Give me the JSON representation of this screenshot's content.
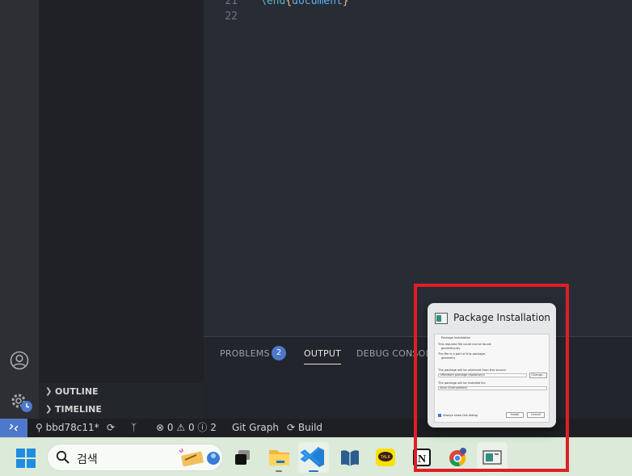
{
  "editor": {
    "lines": [
      {
        "number": "21",
        "keyword": "\\end",
        "open": "{",
        "arg": "document",
        "close": "}"
      },
      {
        "number": "22",
        "keyword": "",
        "open": "",
        "arg": "",
        "close": ""
      }
    ]
  },
  "sidebar": {
    "sections": [
      {
        "label": "OUTLINE"
      },
      {
        "label": "TIMELINE"
      }
    ]
  },
  "panel": {
    "tabs": [
      "PROBLEMS",
      "OUTPUT",
      "DEBUG CONSOLE"
    ],
    "active_tab": "OUTPUT",
    "problems_count": "2"
  },
  "status_bar": {
    "branch": "bbd78c11*",
    "errors": "0",
    "warnings": "0",
    "infos": "2",
    "git_graph": "Git Graph",
    "build": "Build"
  },
  "taskbar": {
    "search_placeholder": "검색",
    "apps": [
      "file-explorer",
      "task-view",
      "vscode",
      "calibre",
      "kakaotalk",
      "notion",
      "chrome",
      "package-installer"
    ]
  },
  "popup": {
    "title": "Package Installation",
    "dialog": {
      "heading": "Package Installation",
      "line1": "This required file could not be found:",
      "file": "geometry.sty",
      "line2": "The file is a part of this package:",
      "package": "geometry",
      "line3": "The package will be retrieved from this source:",
      "source": "<Random package repository>",
      "change": "Change...",
      "line4": "The package will be installed for:",
      "scope": "Sean (Everywhere)",
      "always_show": "Always show this dialog",
      "install": "Install",
      "cancel": "Cancel"
    }
  },
  "colors": {
    "highlight": "#e01e26",
    "accent": "#4d78cc"
  }
}
